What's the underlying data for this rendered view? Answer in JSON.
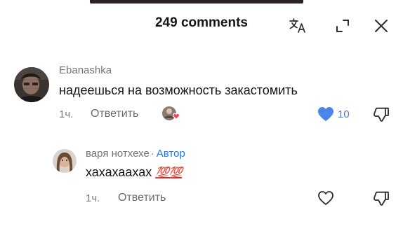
{
  "header": {
    "title": "249 comments"
  },
  "comments": [
    {
      "author": "Ebanashka",
      "text": "надеешься на возможность закастомить",
      "time": "1ч.",
      "reply_label": "Ответить",
      "likes": "10"
    },
    {
      "author": "варя нотхехе",
      "author_separator": "·",
      "badge": "Автор",
      "text": "хахахаахах",
      "emoji": "💯💯",
      "time": "1ч.",
      "reply_label": "Ответить"
    }
  ],
  "colors": {
    "like_active": "#4a86e8",
    "author_badge": "#1877f2",
    "creator_heart": "#ff3b5c"
  }
}
